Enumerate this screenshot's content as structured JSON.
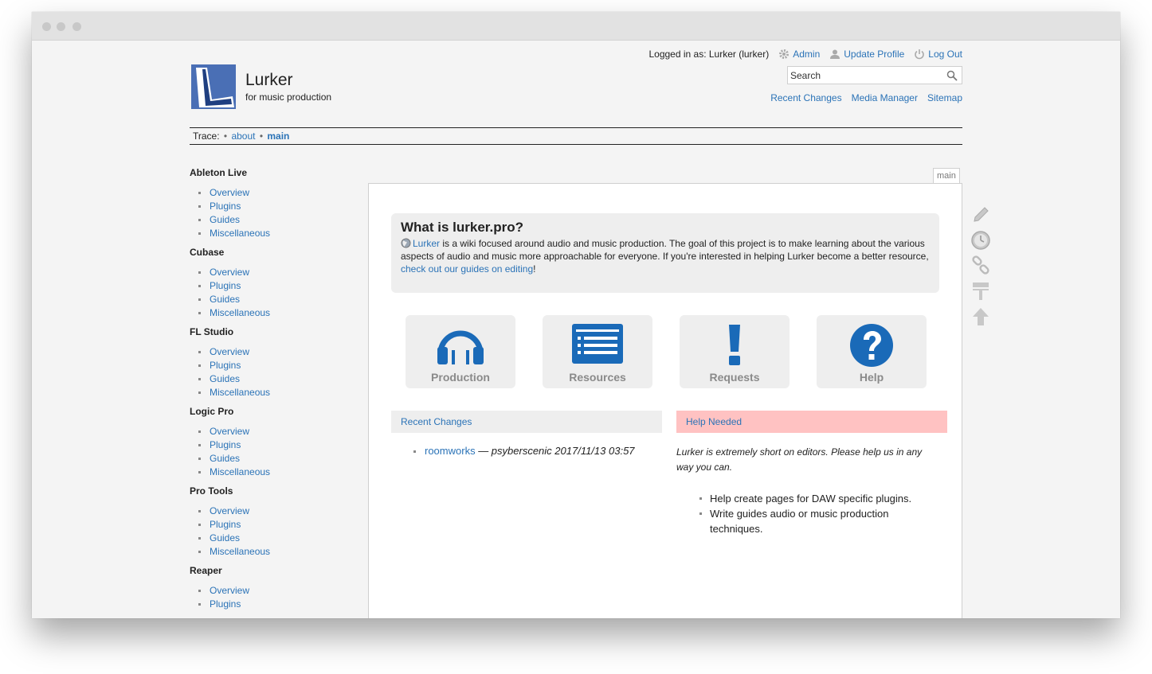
{
  "header": {
    "site_title": "Lurker",
    "tagline": "for music production",
    "logged_in": "Logged in as: Lurker (lurker)",
    "admin": "Admin",
    "update_profile": "Update Profile",
    "log_out": "Log Out",
    "search_placeholder": "Search",
    "recent_changes": "Recent Changes",
    "media_manager": "Media Manager",
    "sitemap": "Sitemap"
  },
  "trace": {
    "label": "Trace:",
    "items": [
      "about",
      "main"
    ]
  },
  "sidebar": {
    "sections": [
      {
        "title": "Ableton Live",
        "items": [
          "Overview",
          "Plugins",
          "Guides",
          "Miscellaneous"
        ]
      },
      {
        "title": "Cubase",
        "items": [
          "Overview",
          "Plugins",
          "Guides",
          "Miscellaneous"
        ]
      },
      {
        "title": "FL Studio",
        "items": [
          "Overview",
          "Plugins",
          "Guides",
          "Miscellaneous"
        ]
      },
      {
        "title": "Logic Pro",
        "items": [
          "Overview",
          "Plugins",
          "Guides",
          "Miscellaneous"
        ]
      },
      {
        "title": "Pro Tools",
        "items": [
          "Overview",
          "Plugins",
          "Guides",
          "Miscellaneous"
        ]
      },
      {
        "title": "Reaper",
        "items": [
          "Overview",
          "Plugins"
        ]
      }
    ]
  },
  "content": {
    "tab_label": "main",
    "intro_title": "What is lurker.pro?",
    "intro_link": "Lurker",
    "intro_text": " is a wiki focused around audio and music production. The goal of this project is to make learning about the various aspects of audio and music more approachable for everyone. If you're interested in helping Lurker become a better resource, ",
    "intro_edit_link": "check out our guides on editing",
    "intro_end": "!",
    "tiles": [
      {
        "label": "Production",
        "icon": "headphones-icon"
      },
      {
        "label": "Resources",
        "icon": "list-icon"
      },
      {
        "label": "Requests",
        "icon": "exclamation-icon"
      },
      {
        "label": "Help",
        "icon": "question-icon"
      }
    ],
    "recent_changes_heading": "Recent Changes",
    "recent_changes": [
      {
        "page": "roomworks",
        "meta": " — psyberscenic 2017/11/13 03:57"
      }
    ],
    "help_needed_heading": "Help Needed",
    "help_note": "Lurker is extremely short on editors. Please help us in any way you can.",
    "help_items": [
      "Help create pages for DAW specific plugins.",
      "Write guides audio or music production techniques."
    ]
  },
  "page_tools": [
    "edit-icon",
    "revisions-icon",
    "backlinks-icon",
    "tool-icon",
    "back-to-top-icon"
  ],
  "colors": {
    "link": "#2b73b7",
    "accent_blue": "#1a6ab8",
    "help_needed_bg": "#ffc2c2",
    "logo_blue": "#4a6fb5"
  }
}
